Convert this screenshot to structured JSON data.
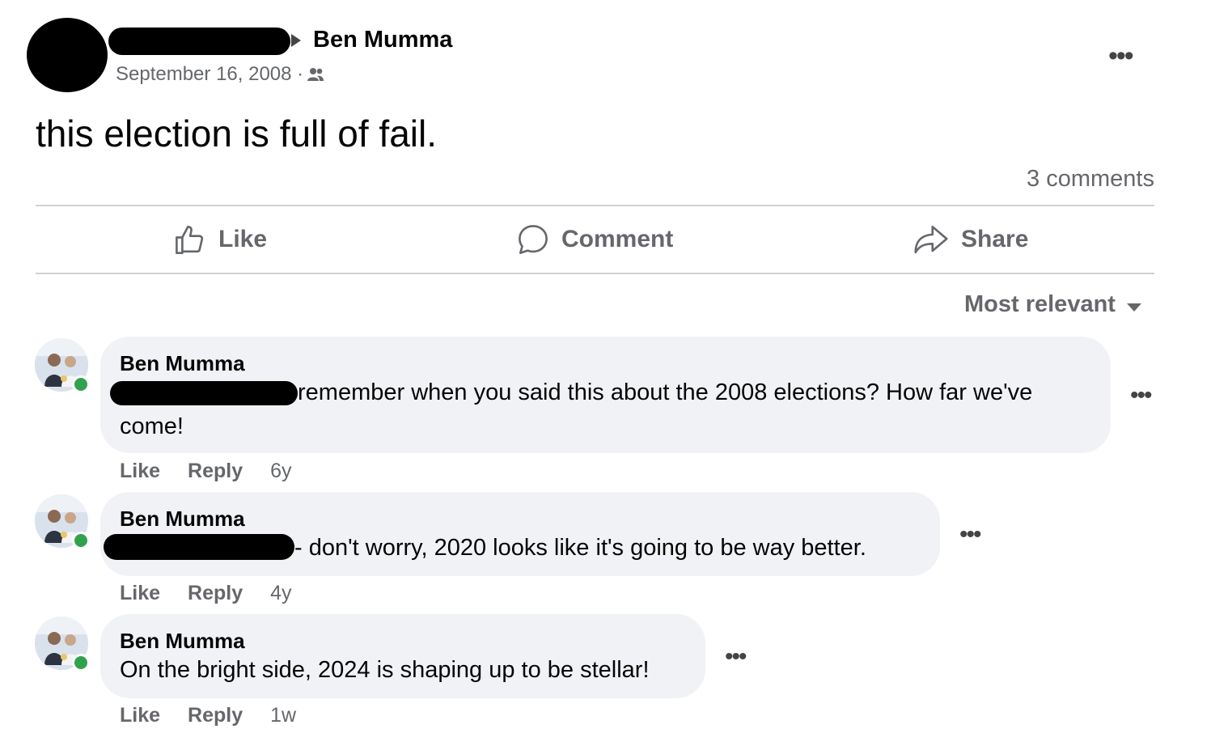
{
  "post": {
    "target_name": "Ben Mumma",
    "date": "September 16, 2008 · ",
    "audience_icon": "friends-icon",
    "more": "•••",
    "text": "this election is full of fail.",
    "comment_count": "3 comments"
  },
  "actions": {
    "like": "Like",
    "comment": "Comment",
    "share": "Share"
  },
  "sort": {
    "label": "Most relevant"
  },
  "comments": [
    {
      "author": "Ben Mumma",
      "text_line1": "remember when you said this about the 2008 elections? How far we've",
      "text_line2": "come!",
      "like": "Like",
      "reply": "Reply",
      "time": "6y"
    },
    {
      "author": "Ben Mumma",
      "text": "- don't worry, 2020 looks like it's going to be way better.",
      "like": "Like",
      "reply": "Reply",
      "time": "4y"
    },
    {
      "author": "Ben Mumma",
      "text": "On the bright side, 2024 is shaping up to be stellar!",
      "like": "Like",
      "reply": "Reply",
      "time": "1w"
    }
  ],
  "more_glyph": "•••",
  "colors": {
    "secondary_text": "#65676b",
    "bubble_bg": "#f0f2f5",
    "online_dot": "#31a24c",
    "divider": "#ced0d4"
  }
}
